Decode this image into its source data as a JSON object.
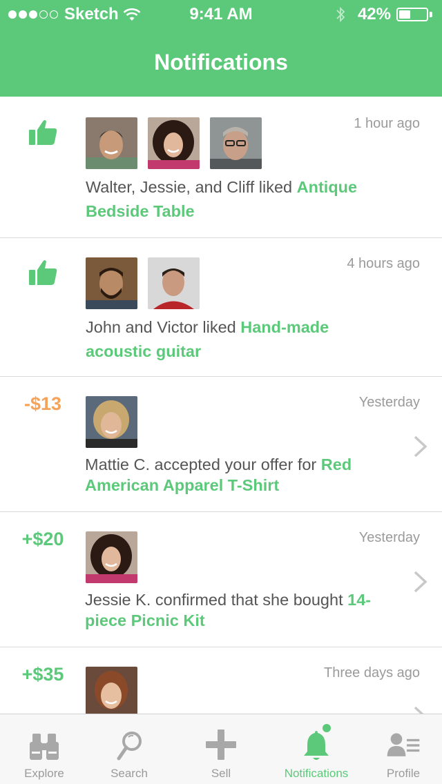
{
  "status_bar": {
    "carrier": "Sketch",
    "time": "9:41 AM",
    "battery": "42%",
    "battery_level": 0.42
  },
  "header": {
    "title": "Notifications"
  },
  "colors": {
    "accent": "#5cc97a",
    "negative": "#f6a35a",
    "muted": "#9a9a9a"
  },
  "notifications": [
    {
      "type": "like",
      "icon": "thumbs-up-icon",
      "time": "1 hour ago",
      "avatars": 3,
      "text": "Walter, Jessie, and Cliff liked ",
      "item": "Antique Bedside Table"
    },
    {
      "type": "like",
      "icon": "thumbs-up-icon",
      "time": "4 hours ago",
      "avatars": 2,
      "text": "John and Victor liked ",
      "item": "Hand-made acoustic guitar"
    },
    {
      "type": "offer",
      "amount": "-$13",
      "time": "Yesterday",
      "avatars": 1,
      "text": "Mattie C. accepted your offer for ",
      "item": "Red American Apparel T-Shirt"
    },
    {
      "type": "sale",
      "amount": "+$20",
      "time": "Yesterday",
      "avatars": 1,
      "text": "Jessie K. confirmed that she bought ",
      "item": "14-piece Picnic Kit"
    },
    {
      "type": "sale",
      "amount": "+$35",
      "time": "Three days ago",
      "avatars": 1
    }
  ],
  "tabs": [
    {
      "label": "Explore",
      "icon": "binoculars-icon"
    },
    {
      "label": "Search",
      "icon": "magnifier-icon"
    },
    {
      "label": "Sell",
      "icon": "plus-icon"
    },
    {
      "label": "Notifications",
      "icon": "bell-icon",
      "active": true
    },
    {
      "label": "Profile",
      "icon": "profile-icon"
    }
  ]
}
